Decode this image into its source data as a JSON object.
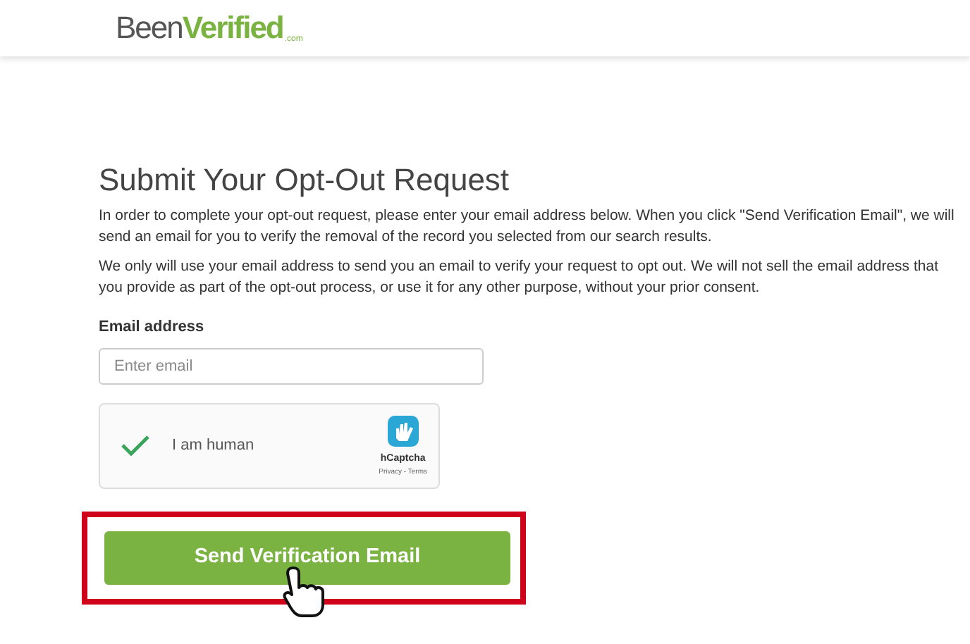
{
  "logo": {
    "part_1": "Been",
    "part_2": "Verified",
    "suffix": ".com"
  },
  "title": "Submit Your Opt-Out Request",
  "paragraphs": [
    "In order to complete your opt-out request, please enter your email address below. When you click \"Send Verification Email\", we will send an email for you to verify the removal of the record you selected from our search results.",
    "We only will use your email address to send you an email to verify your request to opt out. We will not sell the email address that you provide as part of the opt-out process, or use it for any other purpose, without your prior consent."
  ],
  "email_field": {
    "label": "Email address",
    "placeholder": "Enter email"
  },
  "captcha": {
    "label": "I am human",
    "checked": true,
    "brand": "hCaptcha",
    "links": "Privacy - Terms"
  },
  "submit_button": {
    "label": "Send Verification Email",
    "highlighted": true
  }
}
